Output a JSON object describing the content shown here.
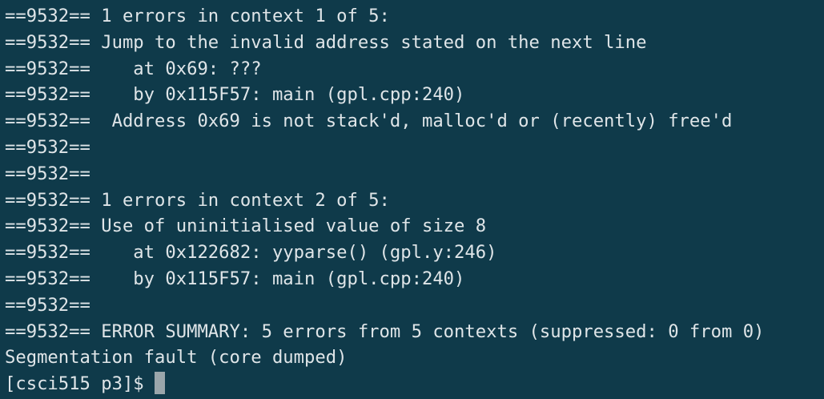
{
  "terminal": {
    "lines": [
      "==9532== 1 errors in context 1 of 5:",
      "==9532== Jump to the invalid address stated on the next line",
      "==9532==    at 0x69: ???",
      "==9532==    by 0x115F57: main (gpl.cpp:240)",
      "==9532==  Address 0x69 is not stack'd, malloc'd or (recently) free'd",
      "==9532==",
      "==9532==",
      "==9532== 1 errors in context 2 of 5:",
      "==9532== Use of uninitialised value of size 8",
      "==9532==    at 0x122682: yyparse() (gpl.y:246)",
      "==9532==    by 0x115F57: main (gpl.cpp:240)",
      "==9532==",
      "==9532== ERROR SUMMARY: 5 errors from 5 contexts (suppressed: 0 from 0)",
      "Segmentation fault (core dumped)"
    ],
    "prompt": "[csci515 p3]$ "
  }
}
